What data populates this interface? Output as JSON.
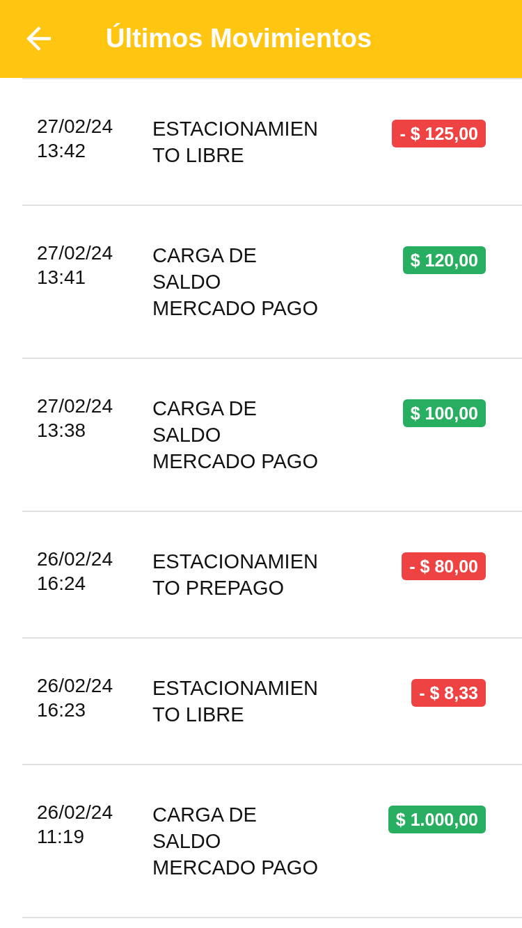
{
  "header": {
    "title": "Últimos Movimientos"
  },
  "movements": [
    {
      "date": "27/02/24",
      "time": "13:42",
      "description": "ESTACIONAMIENTO LIBRE",
      "amount": "- $ 125,00",
      "kind": "debit"
    },
    {
      "date": "27/02/24",
      "time": "13:41",
      "description": "CARGA DE SALDO MERCADO PAGO",
      "amount": "$ 120,00",
      "kind": "credit"
    },
    {
      "date": "27/02/24",
      "time": "13:38",
      "description": "CARGA DE SALDO MERCADO PAGO",
      "amount": "$ 100,00",
      "kind": "credit"
    },
    {
      "date": "26/02/24",
      "time": "16:24",
      "description": "ESTACIONAMIENTO PREPAGO",
      "amount": "- $ 80,00",
      "kind": "debit"
    },
    {
      "date": "26/02/24",
      "time": "16:23",
      "description": "ESTACIONAMIENTO LIBRE",
      "amount": "- $ 8,33",
      "kind": "debit"
    },
    {
      "date": "26/02/24",
      "time": "11:19",
      "description": "CARGA DE SALDO MERCADO PAGO",
      "amount": "$ 1.000,00",
      "kind": "credit"
    }
  ]
}
